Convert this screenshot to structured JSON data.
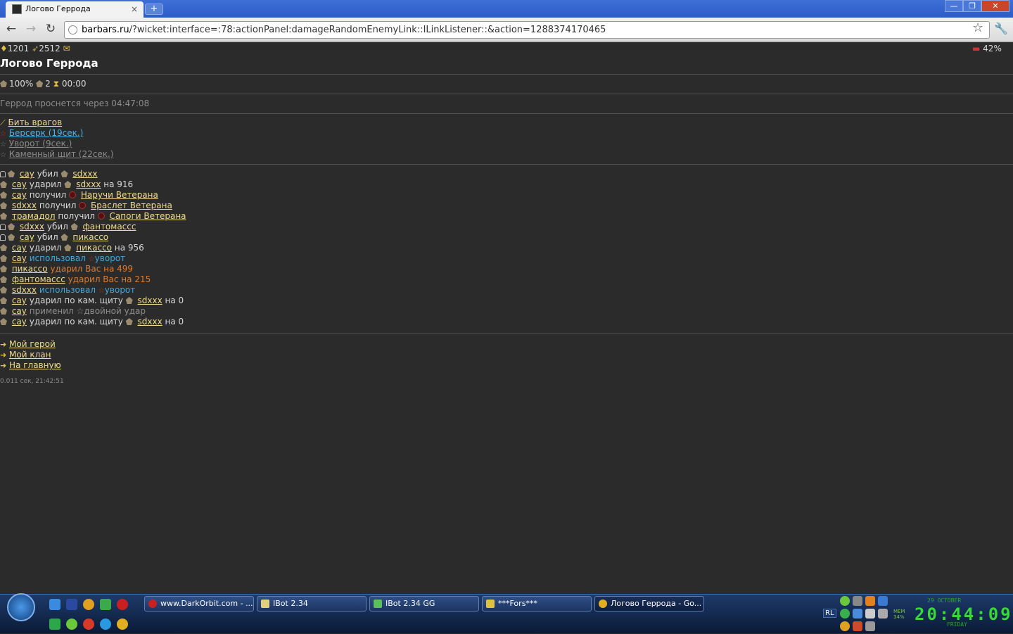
{
  "browser": {
    "tab_title": "Логово Геррода",
    "tab_close": "×",
    "new_tab": "+",
    "url_host": "barbars.ru",
    "url_path": "/?wicket:interface=:78:actionPanel:damageRandomEnemyLink::ILinkListener::&action=1288374170465",
    "controls": {
      "minimize": "—",
      "restore": "❐",
      "close": "✕"
    },
    "back": "←",
    "forward": "→",
    "reload": "↻",
    "bookmark": "☆",
    "wrench": "🔧"
  },
  "status": {
    "gold": "1201",
    "silver": "2512",
    "percent": "42%"
  },
  "page": {
    "title": "Логово Геррода",
    "stats": {
      "health": "100%",
      "level": "2",
      "timer": "00:00"
    },
    "wake_text": "Геррод проснется через 04:47:08",
    "actions": [
      {
        "label": "Бить врагов",
        "style": "link"
      },
      {
        "label": "Берсерк (19сек.)",
        "style": "blue"
      },
      {
        "label": "Уворот (9сек.)",
        "style": "grey"
      },
      {
        "label": "Каменный щит (22сек.)",
        "style": "grey"
      }
    ],
    "log": {
      "l1": {
        "a": "сау",
        "v": "убил",
        "b": "sdxxx"
      },
      "l2": {
        "a": "сау",
        "v": "ударил",
        "b": "sdxxx",
        "t": "на 916"
      },
      "l3": {
        "a": "сау",
        "v": "получил",
        "b": "Наручи Ветерана"
      },
      "l4": {
        "a": "sdxxx",
        "v": "получил",
        "b": "Браслет Ветерана"
      },
      "l5": {
        "a": "трамадол",
        "v": "получил",
        "b": "Сапоги Ветерана"
      },
      "l6": {
        "a": "sdxxx",
        "v": "убил",
        "b": "фантомассс"
      },
      "l7": {
        "a": "сау",
        "v": "убил",
        "b": "пикассо"
      },
      "l8": {
        "a": "сау",
        "v": "ударил",
        "b": "пикассо",
        "t": "на 956"
      },
      "l9": {
        "a": "сау",
        "v": "использовал",
        "b": "уворот"
      },
      "l10": {
        "a": "пикассо",
        "v": "ударил Вас на 499"
      },
      "l11": {
        "a": "фантомассс",
        "v": "ударил Вас на 215"
      },
      "l12": {
        "a": "sdxxx",
        "v": "использовал",
        "b": "уворот"
      },
      "l13": {
        "a": "сау",
        "v": "ударил по кам. щиту",
        "b": "sdxxx",
        "t": "на 0"
      },
      "l14": {
        "a": "сау",
        "v": "применил",
        "b": "двойной удар"
      },
      "l15": {
        "a": "сау",
        "v": "ударил по кам. щиту",
        "b": "sdxxx",
        "t": "на 0"
      }
    },
    "nav": [
      "Мой герой",
      "Мой клан",
      "На главную"
    ],
    "footer": "0.011 сек, 21:42:51"
  },
  "taskbar": {
    "tasks": [
      "www.DarkOrbit.com - ...",
      "IBot 2.34",
      "IBot 2.34 GG",
      "***Fors***",
      "Логово Геррода - Go..."
    ],
    "lang": "RL",
    "mem": "MEM",
    "mem_val": "34%",
    "clock": "20:44:09",
    "date": "29 OCTOBER",
    "day": "FRIDAY"
  },
  "colors": {
    "page_bg": "#2b2b2b",
    "link": "#f0dc8c",
    "blue": "#3fa9e0",
    "orange": "#e07a28"
  }
}
